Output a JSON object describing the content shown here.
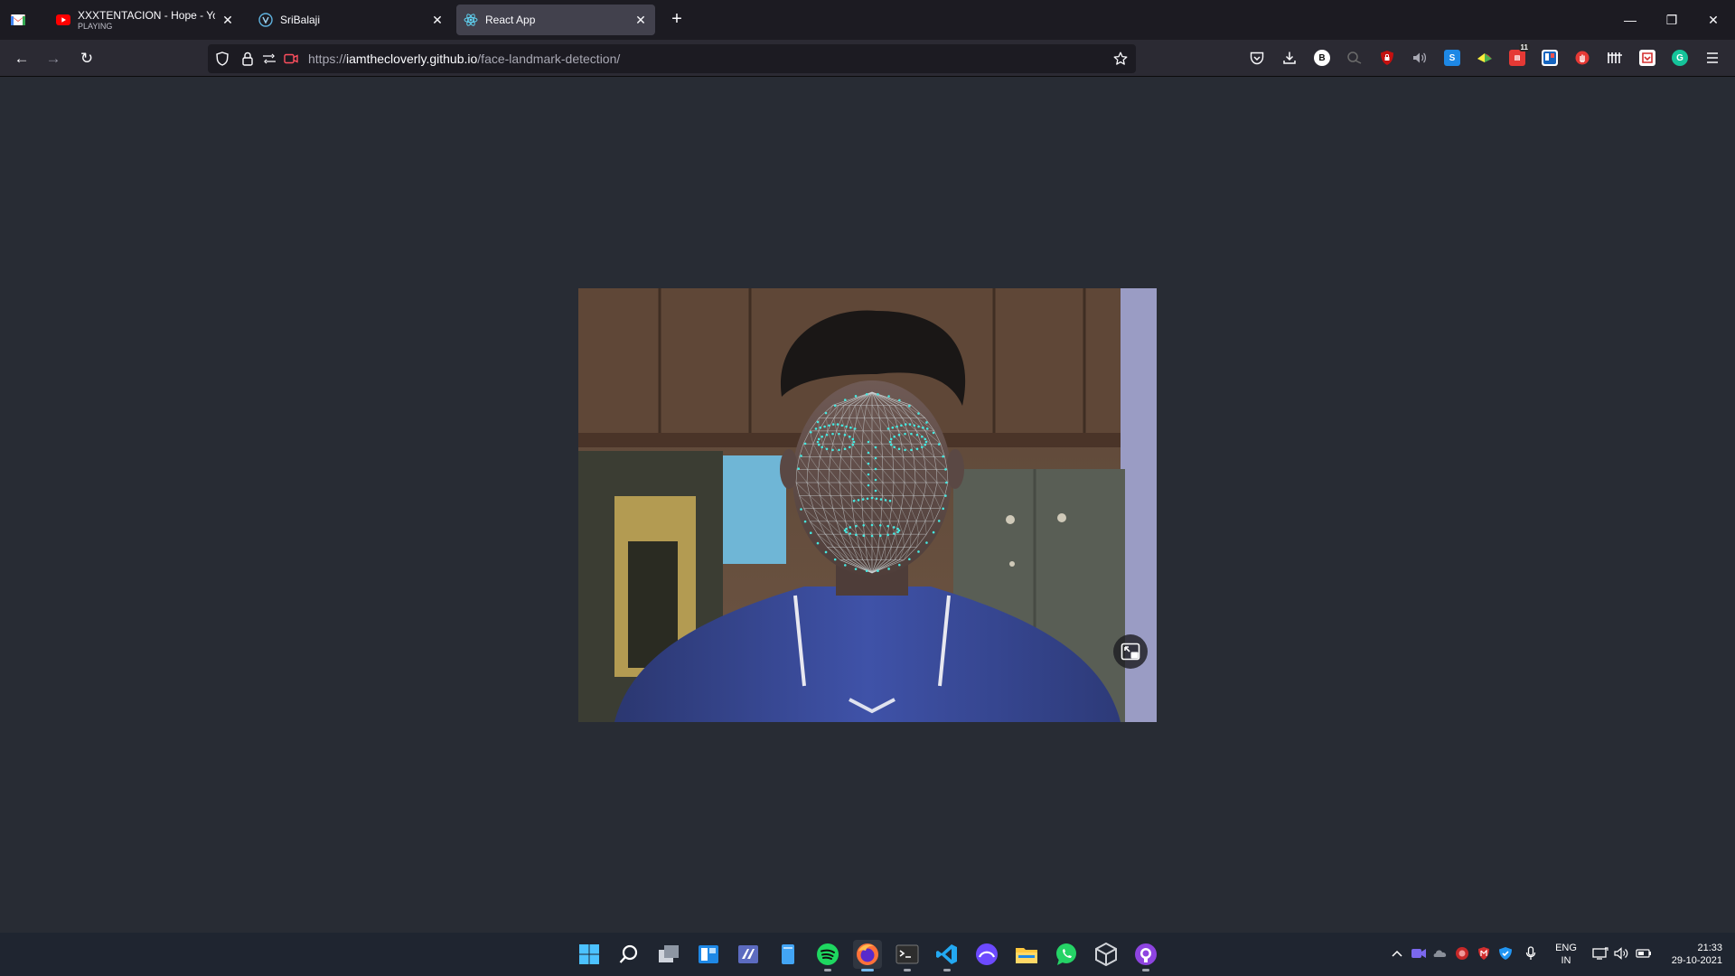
{
  "tabs": [
    {
      "title": "XXXTENTACION - Hope - YouTube",
      "sub": "PLAYING",
      "icon": "youtube-icon"
    },
    {
      "title": "SriBalaji",
      "sub": "",
      "icon": "vuetify-icon"
    },
    {
      "title": "React App",
      "sub": "",
      "icon": "react-icon",
      "active": true
    }
  ],
  "pinned_tab_icon": "gmail-icon",
  "close_glyph": "✕",
  "new_tab_glyph": "+",
  "window_controls": {
    "minimize": "—",
    "restore": "❐",
    "close": "✕"
  },
  "nav": {
    "back": "←",
    "forward": "→",
    "reload": "↻"
  },
  "url": {
    "scheme": "https://",
    "host": "iamthecloverly.github.io",
    "path": "/face-landmark-detection/",
    "full": "https://iamthecloverly.github.io/face-landmark-detection/"
  },
  "extensions": [
    "pocket-icon",
    "download-icon",
    "b-ext-icon",
    "dark-reader-icon",
    "ublock-icon",
    "volume-icon",
    "s-ext-icon",
    "color-ext-icon",
    "calendar-ext-icon",
    "trello-ext-icon",
    "red-hand-icon",
    "grid-ext-icon",
    "pdf-ext-icon",
    "grammarly-icon"
  ],
  "extension_badge": "11",
  "taskbar": {
    "apps": [
      "windows-start-icon",
      "search-icon",
      "task-view-icon",
      "widgets-icon",
      "visual-studio-icon",
      "notepad-icon",
      "spotify-icon",
      "firefox-icon",
      "terminal-icon",
      "vscode-icon",
      "proton-icon",
      "file-explorer-icon",
      "whatsapp-icon",
      "unity-icon",
      "github-desktop-icon"
    ],
    "language": {
      "line1": "ENG",
      "line2": "IN"
    },
    "clock": {
      "time": "21:33",
      "date": "29-10-2021"
    }
  },
  "colors": {
    "page_bg": "#282c34",
    "tab_strip": "#1c1b22",
    "nav_bar": "#2b2a33",
    "mesh": "#46e8e0"
  }
}
